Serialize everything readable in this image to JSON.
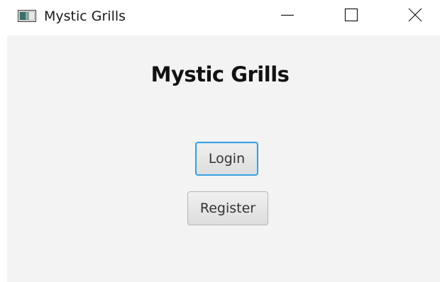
{
  "window": {
    "title": "Mystic Grills",
    "app_icon": "window-app-icon",
    "controls": {
      "minimize_icon": "minimize-icon",
      "maximize_icon": "maximize-icon",
      "close_icon": "close-icon"
    }
  },
  "main": {
    "heading": "Mystic Grills",
    "login_label": "Login",
    "register_label": "Register"
  },
  "colors": {
    "background": "#f3f3f3",
    "focus_border": "#3b9ddf"
  }
}
